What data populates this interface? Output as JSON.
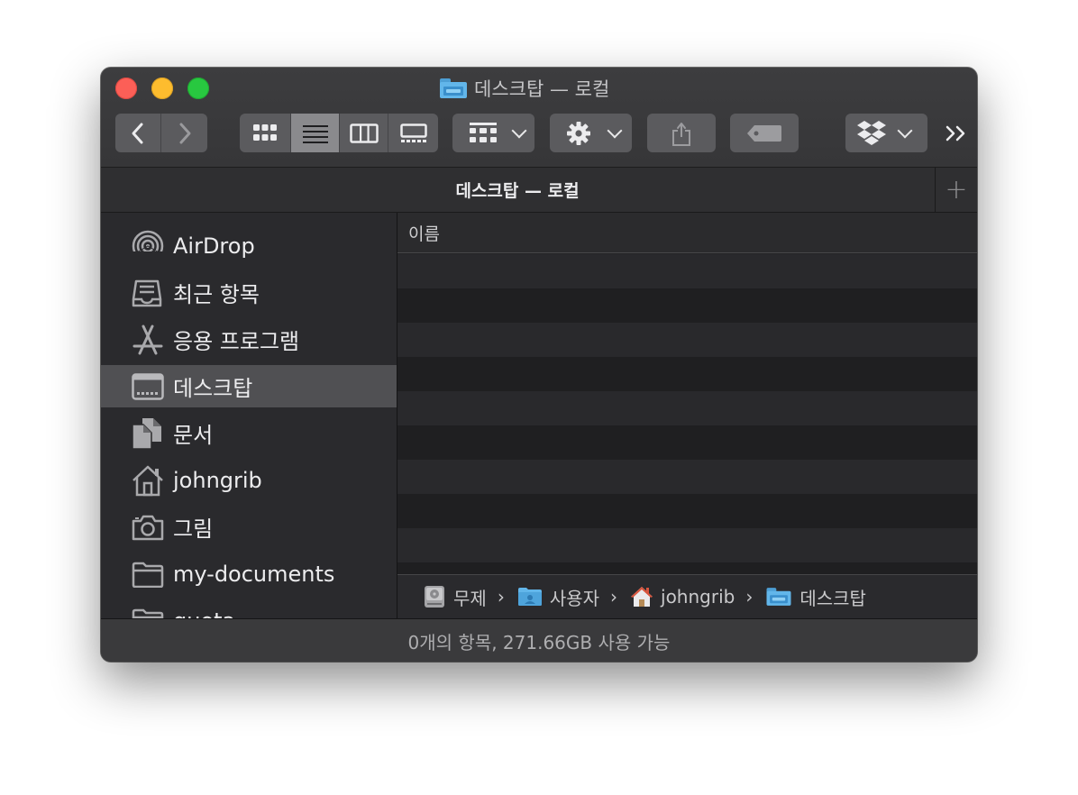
{
  "window": {
    "title": "데스크탑 — 로컬"
  },
  "toolbar": {
    "back": "back",
    "forward": "forward",
    "view_modes": [
      "icon-view",
      "list-view",
      "column-view",
      "gallery-view"
    ],
    "active_view": "list-view",
    "more": "»"
  },
  "tabbar": {
    "title": "데스크탑 — 로컬",
    "add": "+"
  },
  "sidebar": {
    "items": [
      {
        "label": "AirDrop",
        "icon": "airdrop-icon"
      },
      {
        "label": "최근 항목",
        "icon": "recents-icon"
      },
      {
        "label": "응용 프로그램",
        "icon": "applications-icon"
      },
      {
        "label": "데스크탑",
        "icon": "desktop-icon",
        "selected": true
      },
      {
        "label": "문서",
        "icon": "documents-icon"
      },
      {
        "label": "johngrib",
        "icon": "home-icon"
      },
      {
        "label": "그림",
        "icon": "camera-icon"
      },
      {
        "label": "my-documents",
        "icon": "folder-icon"
      },
      {
        "label": "quota",
        "icon": "folder-icon"
      }
    ]
  },
  "list": {
    "column_name": "이름",
    "rows": []
  },
  "pathbar": {
    "crumbs": [
      {
        "label": "무제",
        "icon": "disk-icon"
      },
      {
        "label": "사용자",
        "icon": "users-folder-icon"
      },
      {
        "label": "johngrib",
        "icon": "home-icon"
      },
      {
        "label": "데스크탑",
        "icon": "desktop-folder-icon"
      }
    ],
    "separator": "›"
  },
  "status": {
    "text": "0개의 항목, 271.66GB 사용 가능"
  },
  "colors": {
    "accent_folder": "#62b6ea",
    "selection": "#505053",
    "close": "#fc5f57",
    "minimize": "#fdbc2e",
    "zoom": "#28c840"
  }
}
